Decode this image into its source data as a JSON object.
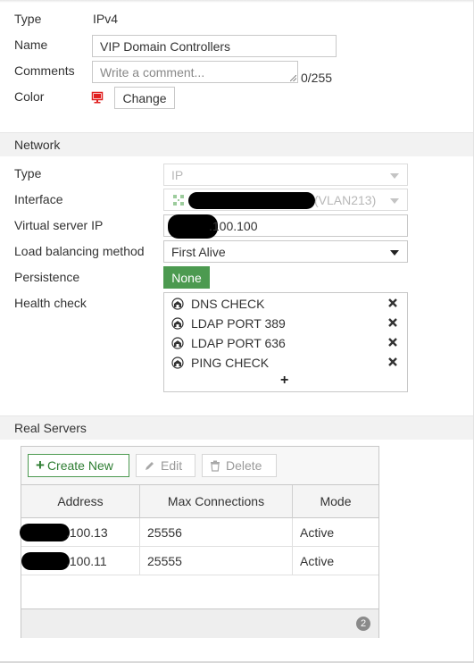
{
  "form": {
    "type_label": "Type",
    "type_value": "IPv4",
    "name_label": "Name",
    "name_value": "VIP Domain Controllers",
    "comments_label": "Comments",
    "comments_placeholder": "Write a comment...",
    "comments_counter": "0/255",
    "color_label": "Color",
    "color_change_button": "Change",
    "color_icon": "monitor-icon",
    "color_icon_color": "#e02020"
  },
  "network": {
    "section_title": "Network",
    "type_label": "Type",
    "type_value": "IP",
    "interface_label": "Interface",
    "interface_suffix": "(VLAN213)",
    "vip_label": "Virtual server IP",
    "vip_value_visible": ".100.100",
    "lb_label": "Load balancing method",
    "lb_value": "First Alive",
    "persistence_label": "Persistence",
    "persistence_value": "None",
    "persistence_color": "#4c9a50",
    "health_label": "Health check",
    "health_checks": [
      {
        "name": "DNS CHECK",
        "icon": "health-check-icon"
      },
      {
        "name": "LDAP PORT 389",
        "icon": "health-check-icon"
      },
      {
        "name": "LDAP PORT 636",
        "icon": "health-check-icon"
      },
      {
        "name": "PING CHECK",
        "icon": "health-check-icon"
      }
    ],
    "health_add": "+"
  },
  "real_servers": {
    "section_title": "Real Servers",
    "toolbar": {
      "create_label": "Create New",
      "edit_label": "Edit",
      "delete_label": "Delete"
    },
    "columns": [
      "Address",
      "Max Connections",
      "Mode"
    ],
    "rows": [
      {
        "address": ".100.13",
        "max_connections": "25556",
        "mode": "Active"
      },
      {
        "address": ".100.11",
        "max_connections": "25555",
        "mode": "Active"
      }
    ],
    "count": "2"
  }
}
